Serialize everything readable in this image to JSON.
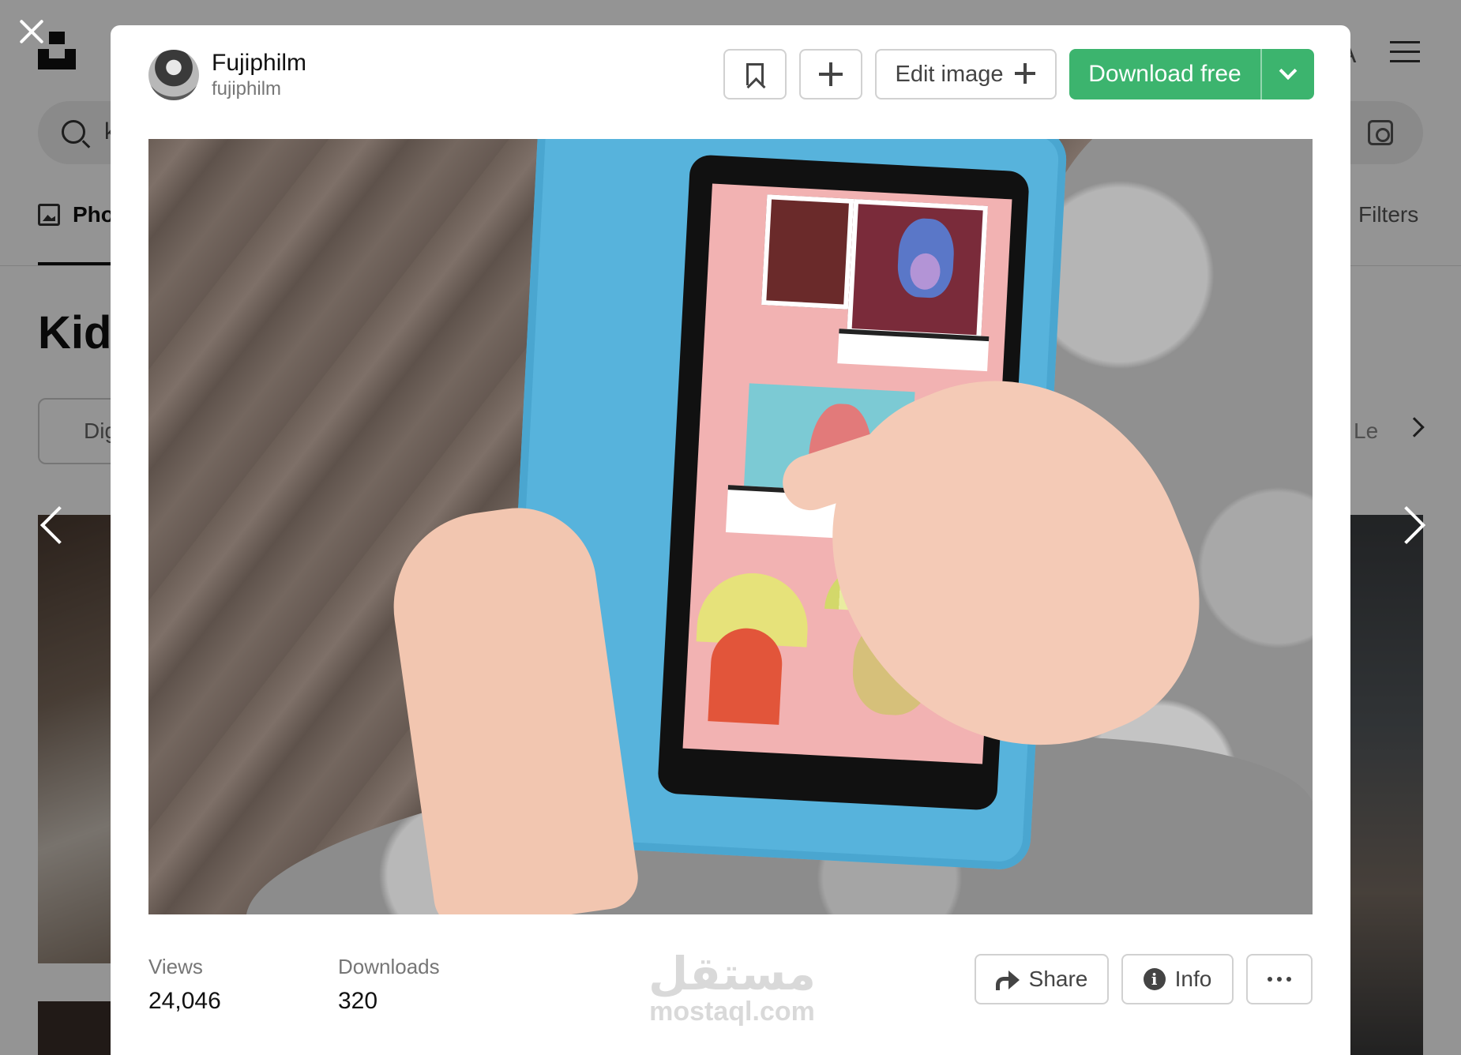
{
  "background": {
    "search_partial_text": "k",
    "tab_photos_label": "Pho",
    "filters_label": "Filters",
    "heading_partial": "Kids",
    "chip_left_partial": "Dig",
    "chip_right_partial": "Le",
    "avatar_letter": "A"
  },
  "modal": {
    "author": {
      "name": "Fujiphilm",
      "handle": "fujiphilm"
    },
    "toolbar": {
      "edit_label": "Edit image",
      "download_label": "Download free"
    },
    "stats": {
      "views_label": "Views",
      "views_value": "24,046",
      "downloads_label": "Downloads",
      "downloads_value": "320"
    },
    "watermark": {
      "arabic": "مستقل",
      "latin": "mostaql.com"
    },
    "footer": {
      "share_label": "Share",
      "info_label": "Info"
    }
  },
  "colors": {
    "download_green": "#3cb46e",
    "border_gray": "#d1d1d1",
    "muted_text": "#767676"
  },
  "icons": [
    "close-icon",
    "bookmark-icon",
    "plus-icon",
    "sparkle-icon",
    "chevron-down-icon",
    "share-icon",
    "info-icon",
    "more-icon",
    "chevron-left-icon",
    "chevron-right-icon",
    "search-icon",
    "visual-search-icon",
    "menu-icon"
  ]
}
